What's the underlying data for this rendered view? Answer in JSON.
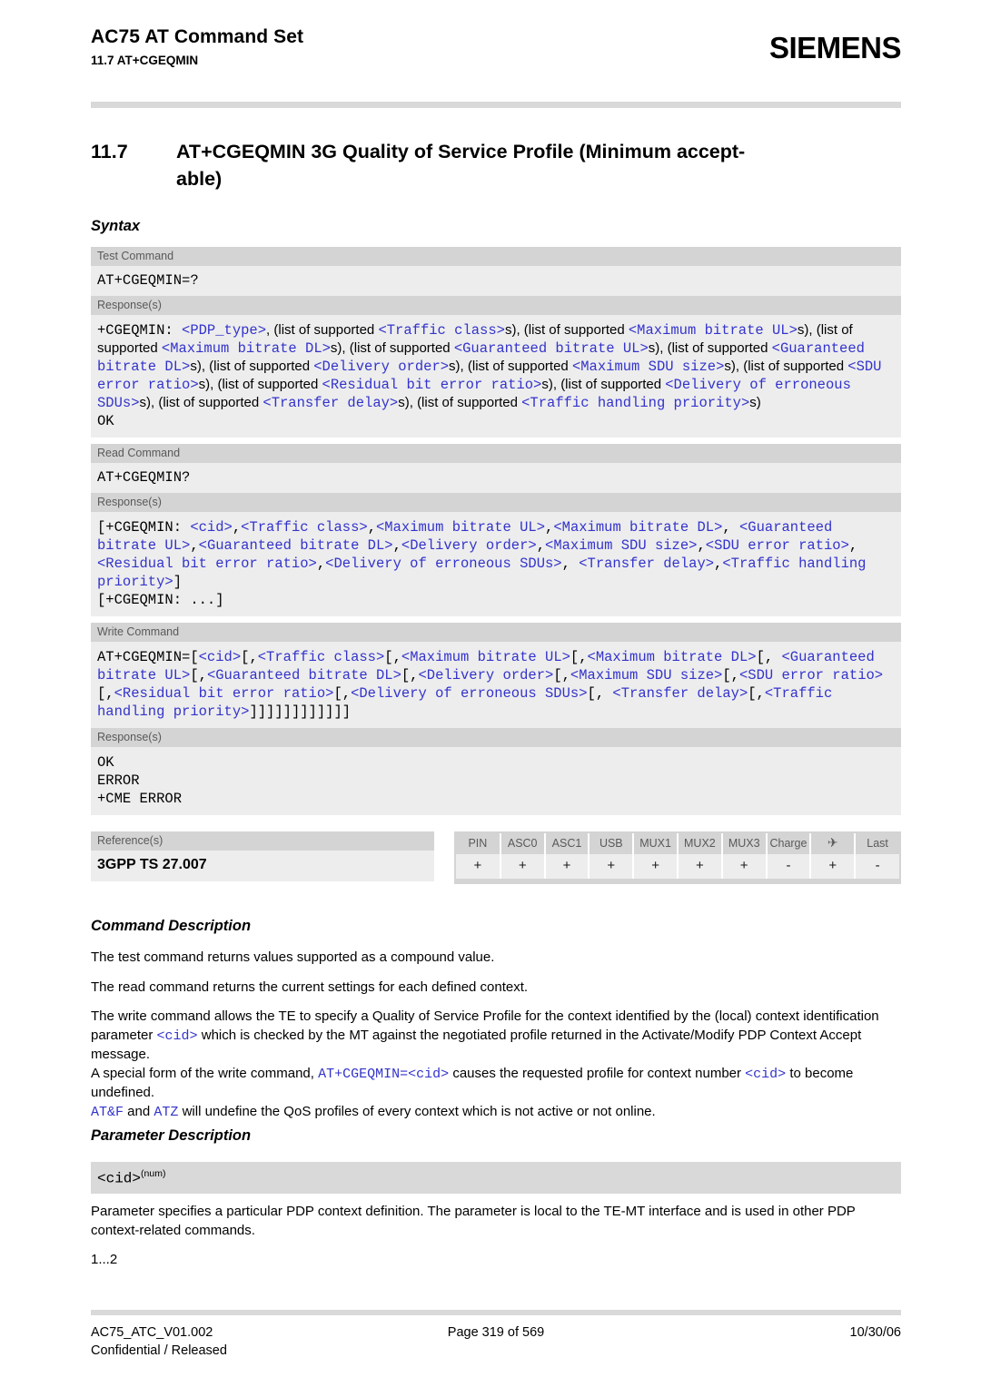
{
  "header": {
    "title": "AC75 AT Command Set",
    "subtitle": "11.7 AT+CGEQMIN",
    "brand": "SIEMENS"
  },
  "section": {
    "number": "11.7",
    "title_line1": "AT+CGEQMIN   3G Quality of Service Profile (Minimum accept-",
    "title_line2": "able)"
  },
  "subheads": {
    "syntax": "Syntax",
    "command_description": "Command Description",
    "parameter_description": "Parameter Description"
  },
  "labels": {
    "test_command": "Test Command",
    "read_command": "Read Command",
    "write_command": "Write Command",
    "responses": "Response(s)",
    "references": "Reference(s)"
  },
  "test_command": {
    "command": "AT+CGEQMIN=?",
    "response_prefix": "+CGEQMIN: ",
    "response_ok": "OK",
    "response_tokens": [
      {
        "t": "code",
        "v": "<PDP_type>",
        "par": true
      },
      {
        "t": "text",
        "v": ", (list of supported "
      },
      {
        "t": "code",
        "v": "<Traffic class>",
        "par": true
      },
      {
        "t": "text",
        "v": "s), (list of supported "
      },
      {
        "t": "code",
        "v": "<Maximum bitrate UL>",
        "par": true
      },
      {
        "t": "text",
        "v": "s), (list of supported "
      },
      {
        "t": "code",
        "v": "<Maximum bitrate DL>",
        "par": true
      },
      {
        "t": "text",
        "v": "s), (list of supported "
      },
      {
        "t": "code",
        "v": "<Guaranteed bitrate UL>",
        "par": true
      },
      {
        "t": "text",
        "v": "s), (list of supported "
      },
      {
        "t": "code",
        "v": "<Guaranteed bitrate DL>",
        "par": true
      },
      {
        "t": "text",
        "v": "s), (list of supported "
      },
      {
        "t": "code",
        "v": "<Delivery order>",
        "par": true
      },
      {
        "t": "text",
        "v": "s), (list of supported "
      },
      {
        "t": "code",
        "v": "<Maximum SDU size>",
        "par": true
      },
      {
        "t": "text",
        "v": "s), (list of supported "
      },
      {
        "t": "code",
        "v": "<SDU error ratio>",
        "par": true
      },
      {
        "t": "text",
        "v": "s), (list of supported "
      },
      {
        "t": "code",
        "v": "<Residual bit error ratio>",
        "par": true
      },
      {
        "t": "text",
        "v": "s), (list of supported "
      },
      {
        "t": "code",
        "v": "<Delivery of erroneous SDUs>",
        "par": true
      },
      {
        "t": "text",
        "v": "s), (list of supported "
      },
      {
        "t": "code",
        "v": "<Transfer delay>",
        "par": true
      },
      {
        "t": "text",
        "v": "s), (list of supported "
      },
      {
        "t": "code",
        "v": "<Traffic handling priority>",
        "par": true
      },
      {
        "t": "text",
        "v": "s)"
      }
    ]
  },
  "read_command": {
    "command": "AT+CGEQMIN?",
    "response_tokens": [
      {
        "t": "code",
        "v": "[+CGEQMIN: ",
        "par": false
      },
      {
        "t": "code",
        "v": "<cid>",
        "par": true
      },
      {
        "t": "code",
        "v": ",",
        "par": false
      },
      {
        "t": "code",
        "v": "<Traffic class>",
        "par": true
      },
      {
        "t": "code",
        "v": ",",
        "par": false
      },
      {
        "t": "code",
        "v": "<Maximum bitrate UL>",
        "par": true
      },
      {
        "t": "code",
        "v": ",",
        "par": false
      },
      {
        "t": "code",
        "v": "<Maximum bitrate DL>",
        "par": true
      },
      {
        "t": "code",
        "v": ", ",
        "par": false
      },
      {
        "t": "code",
        "v": "<Guaranteed bitrate UL>",
        "par": true
      },
      {
        "t": "code",
        "v": ",",
        "par": false
      },
      {
        "t": "code",
        "v": "<Guaranteed bitrate DL>",
        "par": true
      },
      {
        "t": "code",
        "v": ",",
        "par": false
      },
      {
        "t": "code",
        "v": "<Delivery order>",
        "par": true
      },
      {
        "t": "code",
        "v": ",",
        "par": false
      },
      {
        "t": "code",
        "v": "<Maximum SDU size>",
        "par": true
      },
      {
        "t": "code",
        "v": ",",
        "par": false
      },
      {
        "t": "code",
        "v": "<SDU error ratio>",
        "par": true
      },
      {
        "t": "code",
        "v": ",",
        "par": false
      },
      {
        "t": "code",
        "v": "<Residual bit error ratio>",
        "par": true
      },
      {
        "t": "code",
        "v": ",",
        "par": false
      },
      {
        "t": "code",
        "v": "<Delivery of erroneous SDUs>",
        "par": true
      },
      {
        "t": "code",
        "v": ", ",
        "par": false
      },
      {
        "t": "code",
        "v": "<Transfer delay>",
        "par": true
      },
      {
        "t": "code",
        "v": ",",
        "par": false
      },
      {
        "t": "code",
        "v": "<Traffic handling priority>",
        "par": true
      },
      {
        "t": "code",
        "v": "]",
        "par": false
      }
    ],
    "response_line2": "[+CGEQMIN: ...]"
  },
  "write_command": {
    "command_tokens": [
      {
        "t": "code",
        "v": "AT+CGEQMIN=[",
        "par": false
      },
      {
        "t": "code",
        "v": "<cid>",
        "par": true
      },
      {
        "t": "code",
        "v": "[,",
        "par": false
      },
      {
        "t": "code",
        "v": "<Traffic class>",
        "par": true
      },
      {
        "t": "code",
        "v": "[,",
        "par": false
      },
      {
        "t": "code",
        "v": "<Maximum bitrate UL>",
        "par": true
      },
      {
        "t": "code",
        "v": "[,",
        "par": false
      },
      {
        "t": "code",
        "v": "<Maximum bitrate DL>",
        "par": true
      },
      {
        "t": "code",
        "v": "[, ",
        "par": false
      },
      {
        "t": "code",
        "v": "<Guaranteed bitrate UL>",
        "par": true
      },
      {
        "t": "code",
        "v": "[,",
        "par": false
      },
      {
        "t": "code",
        "v": "<Guaranteed bitrate DL>",
        "par": true
      },
      {
        "t": "code",
        "v": "[,",
        "par": false
      },
      {
        "t": "code",
        "v": "<Delivery order>",
        "par": true
      },
      {
        "t": "code",
        "v": "[,",
        "par": false
      },
      {
        "t": "code",
        "v": "<Maximum SDU size>",
        "par": true
      },
      {
        "t": "code",
        "v": "[,",
        "par": false
      },
      {
        "t": "code",
        "v": "<SDU error ratio>",
        "par": true
      },
      {
        "t": "code",
        "v": "[,",
        "par": false
      },
      {
        "t": "code",
        "v": "<Residual bit error ratio>",
        "par": true
      },
      {
        "t": "code",
        "v": "[,",
        "par": false
      },
      {
        "t": "code",
        "v": "<Delivery of erroneous SDUs>",
        "par": true
      },
      {
        "t": "code",
        "v": "[, ",
        "par": false
      },
      {
        "t": "code",
        "v": "<Transfer delay>",
        "par": true
      },
      {
        "t": "code",
        "v": "[,",
        "par": false
      },
      {
        "t": "code",
        "v": "<Traffic handling priority>",
        "par": true
      },
      {
        "t": "code",
        "v": "]]]]]]]]]]]]",
        "par": false
      }
    ],
    "responses": [
      "OK",
      "ERROR",
      "+CME ERROR"
    ]
  },
  "reference": {
    "value": "3GPP TS 27.007"
  },
  "availability": {
    "columns": [
      "PIN",
      "ASC0",
      "ASC1",
      "USB",
      "MUX1",
      "MUX2",
      "MUX3",
      "Charge",
      "airplane-icon",
      "Last"
    ],
    "airplane_glyph": "✈",
    "values": [
      "+",
      "+",
      "+",
      "+",
      "+",
      "+",
      "+",
      "-",
      "+",
      "-"
    ]
  },
  "command_description": {
    "p1": "The test command returns values supported as a compound value.",
    "p2": "The read command returns the current settings for each defined context.",
    "p3_tokens": [
      {
        "t": "text",
        "v": "The write command allows the TE to specify a Quality of Service Profile for the context identified by the (local) context identification parameter "
      },
      {
        "t": "code",
        "v": "<cid>",
        "par": true
      },
      {
        "t": "text",
        "v": " which is checked by the MT against the negotiated profile returned in the Activate/Modify PDP Context Accept message."
      }
    ],
    "p4_tokens": [
      {
        "t": "text",
        "v": "A special form of the write command, "
      },
      {
        "t": "code",
        "v": "AT+CGEQMIN=",
        "par": true
      },
      {
        "t": "code",
        "v": "<cid>",
        "par": true
      },
      {
        "t": "text",
        "v": " causes the requested profile for context number "
      },
      {
        "t": "code",
        "v": "<cid>",
        "par": true
      },
      {
        "t": "text",
        "v": " to become undefined."
      }
    ],
    "p5_tokens": [
      {
        "t": "code",
        "v": "AT&F",
        "par": true
      },
      {
        "t": "text",
        "v": " and "
      },
      {
        "t": "code",
        "v": "ATZ",
        "par": true
      },
      {
        "t": "text",
        "v": " will undefine the QoS profiles of every context which is not active or not online."
      }
    ]
  },
  "parameter_description": {
    "name": "<cid>",
    "superscript": "(num)",
    "body": "Parameter specifies a particular PDP context definition. The parameter is local to the TE-MT interface and is used in other PDP context-related commands.",
    "range": "1...2"
  },
  "footer": {
    "doc_id": "AC75_ATC_V01.002",
    "classification": "Confidential / Released",
    "page": "Page 319 of 569",
    "date": "10/30/06"
  },
  "colors": {
    "parameter_blue": "#3333CC",
    "label_bg": "#D4D4D4",
    "content_bg": "#EDEDED",
    "rule_gray": "#D9D9D9"
  }
}
